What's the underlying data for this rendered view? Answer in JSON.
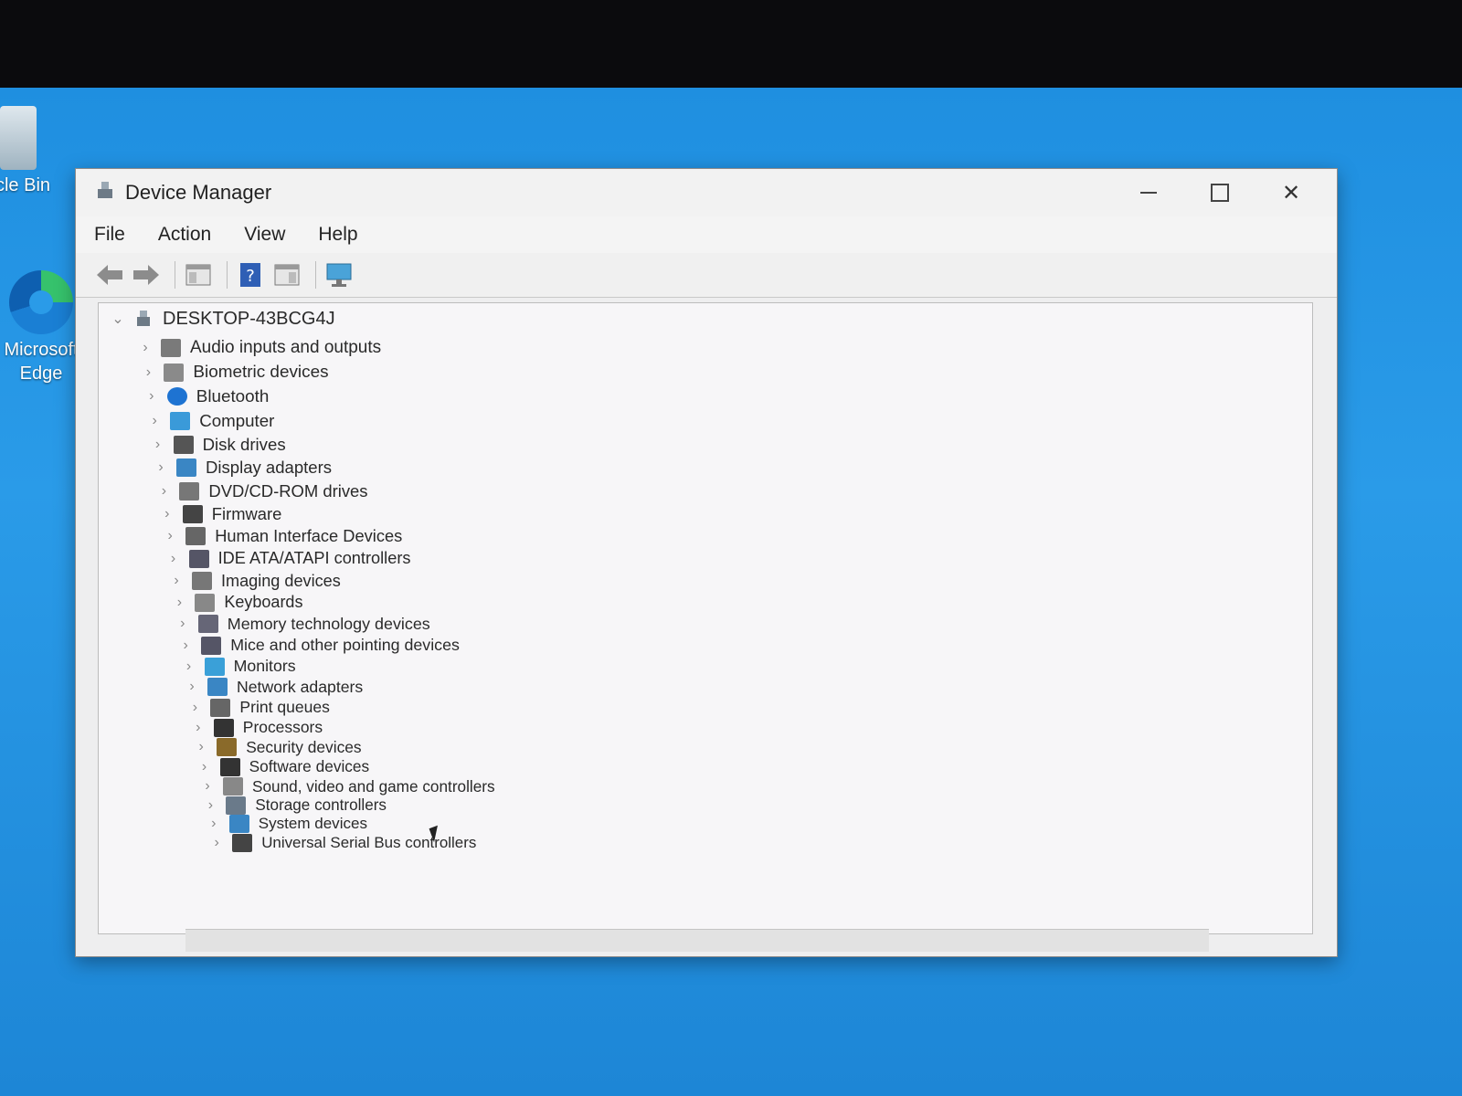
{
  "desktop": {
    "icons": [
      {
        "label": "Recycle Bin",
        "visible_label": "ycle Bin"
      },
      {
        "label": "Microsoft Edge",
        "line1": "Microsoft",
        "line2": "Edge"
      }
    ]
  },
  "window": {
    "title": "Device Manager",
    "menu": [
      "File",
      "Action",
      "View",
      "Help"
    ],
    "toolbar": [
      "back-icon",
      "forward-icon",
      "show-hide-console-tree-icon",
      "help-icon",
      "properties-icon",
      "scan-hardware-icon"
    ]
  },
  "tree": {
    "root": "DESKTOP-43BCG4J",
    "categories": [
      "Audio inputs and outputs",
      "Biometric devices",
      "Bluetooth",
      "Computer",
      "Disk drives",
      "Display adapters",
      "DVD/CD-ROM drives",
      "Firmware",
      "Human Interface Devices",
      "IDE ATA/ATAPI controllers",
      "Imaging devices",
      "Keyboards",
      "Memory technology devices",
      "Mice and other pointing devices",
      "Monitors",
      "Network adapters",
      "Print queues",
      "Processors",
      "Security devices",
      "Software devices",
      "Sound, video and game controllers",
      "Storage controllers",
      "System devices",
      "Universal Serial Bus controllers"
    ]
  },
  "colors": {
    "desktop": "#2a9be8",
    "window_bg": "#eeeeef",
    "tree_bg": "#f7f6f8"
  }
}
